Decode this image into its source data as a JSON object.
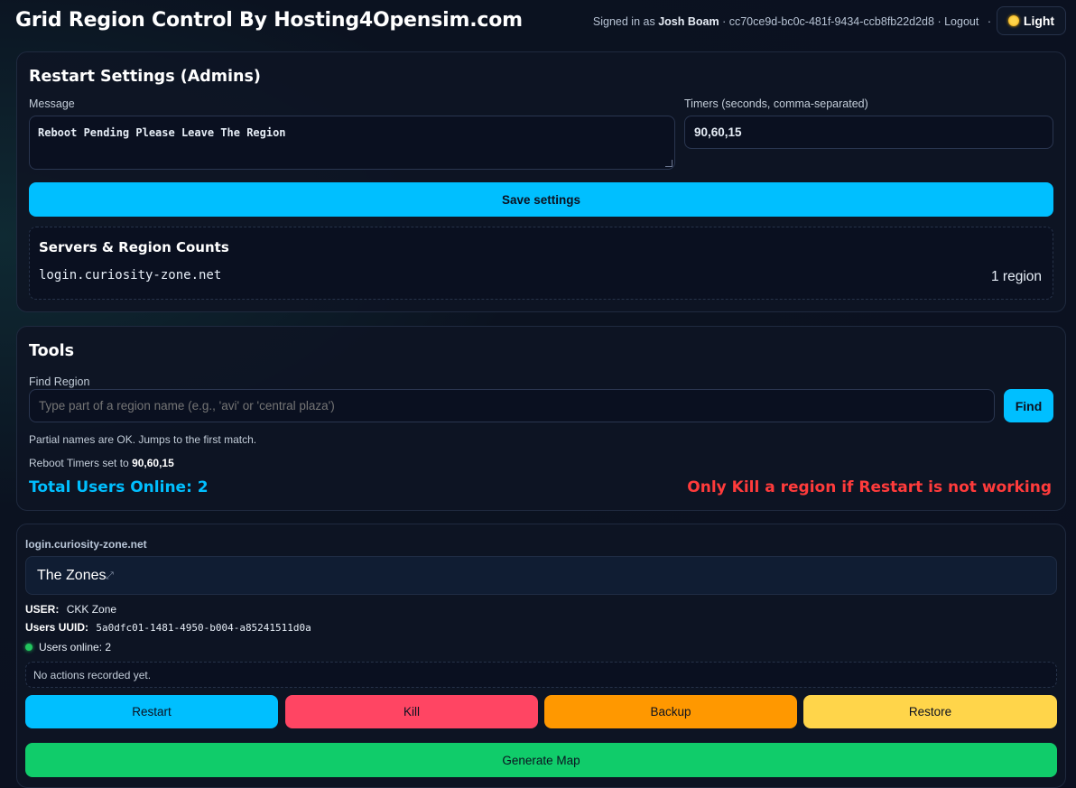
{
  "header": {
    "title": "Grid Region Control By Hosting4Opensim.com",
    "signed_in_prefix": "Signed in as",
    "user_name": "Josh Boam",
    "user_uuid": "cc70ce9d-bc0c-481f-9434-ccb8fb22d2d8",
    "logout_label": "Logout",
    "theme_label": "Light"
  },
  "restart_settings": {
    "title": "Restart Settings (Admins)",
    "message_label": "Message",
    "message_value": "Reboot Pending Please Leave The Region",
    "timers_label": "Timers (seconds, comma-separated)",
    "timers_value": "90,60,15",
    "save_label": "Save settings",
    "servers": {
      "title": "Servers & Region Counts",
      "items": [
        {
          "host": "login.curiosity-zone.net",
          "count": "1 region"
        }
      ]
    }
  },
  "tools": {
    "title": "Tools",
    "find_label": "Find Region",
    "find_placeholder": "Type part of a region name (e.g., 'avi' or 'central plaza')",
    "find_button": "Find",
    "hint": "Partial names are OK. Jumps to the first match.",
    "reboot_timers_prefix": "Reboot Timers set to",
    "reboot_timers_value": "90,60,15",
    "total_users": "Total Users Online: 2",
    "kill_warning": "Only Kill a region if Restart is not working"
  },
  "region": {
    "server": "login.curiosity-zone.net",
    "name": "The Zones",
    "user_label": "USER:",
    "user_value": "CKK Zone",
    "uuid_label": "Users UUID:",
    "uuid_value": "5a0dfc01-1481-4950-b004-a85241511d0a",
    "online_text": "Users online: 2",
    "actions_text": "No actions recorded yet.",
    "buttons": {
      "restart": "Restart",
      "kill": "Kill",
      "backup": "Backup",
      "restore": "Restore",
      "generate_map": "Generate Map"
    }
  },
  "colors": {
    "accent": "#00bfff",
    "kill": "#ff4563",
    "backup": "#ff9800",
    "restore": "#ffd54a",
    "map": "#10cc6a",
    "warning_text": "#ff3b3b",
    "online_dot": "#22c55e"
  }
}
